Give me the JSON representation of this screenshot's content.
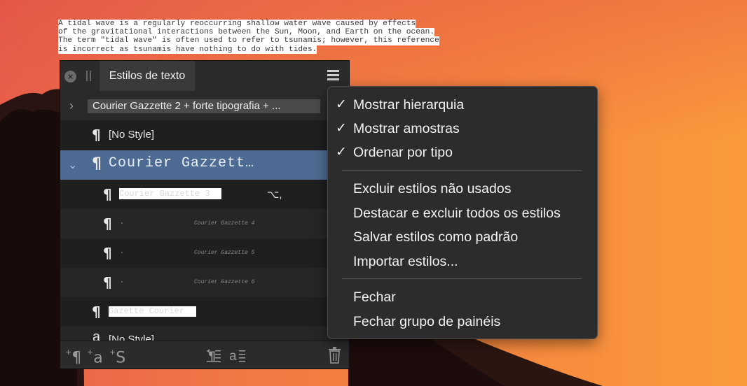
{
  "document": {
    "lines": [
      "A tidal wave is a regularly reoccurring shallow water wave caused by effects",
      "of the gravitational interactions between the Sun, Moon, and Earth on the ocean.",
      "The term \"tidal wave\" is often used to refer to tsunamis; however, this reference",
      "is incorrect as tsunamis have nothing to do with tides."
    ]
  },
  "panel": {
    "tab_label": "Estilos de texto",
    "group_label": "Courier Gazzette 2 + forte tipografia + ...",
    "pilcrow": "¶",
    "rows": {
      "nostyle_label": "[No Style]",
      "selected_label": "Courier Gazzett…",
      "c3_label": "Courier Gazzette 3",
      "c3_shortcut": "⌥,",
      "c4_sample": "Courier Gazzette 4",
      "c5_sample": "Courier Gazzette 5",
      "c6_sample": "Courier Gazzette 6",
      "dot": "·",
      "gazette_label": "Gazette Courier",
      "last_glyph": "a",
      "last_label": "[No Style]"
    },
    "footer": {
      "new_paragraph": "¶",
      "new_character": "a",
      "new_group": "S",
      "plus": "+"
    }
  },
  "context_menu": {
    "items": [
      {
        "label": "Mostrar hierarquia",
        "checked": true
      },
      {
        "label": "Mostrar amostras",
        "checked": true
      },
      {
        "label": "Ordenar por tipo",
        "checked": true
      },
      {
        "label": "Excluir estilos não usados",
        "checked": false
      },
      {
        "label": "Destacar e excluir todos os estilos",
        "checked": false
      },
      {
        "label": "Salvar estilos como padrão",
        "checked": false
      },
      {
        "label": "Importar estilos...",
        "checked": false
      },
      {
        "label": "Fechar",
        "checked": false
      },
      {
        "label": "Fechar grupo de painéis",
        "checked": false
      }
    ],
    "check_glyph": "✓"
  }
}
